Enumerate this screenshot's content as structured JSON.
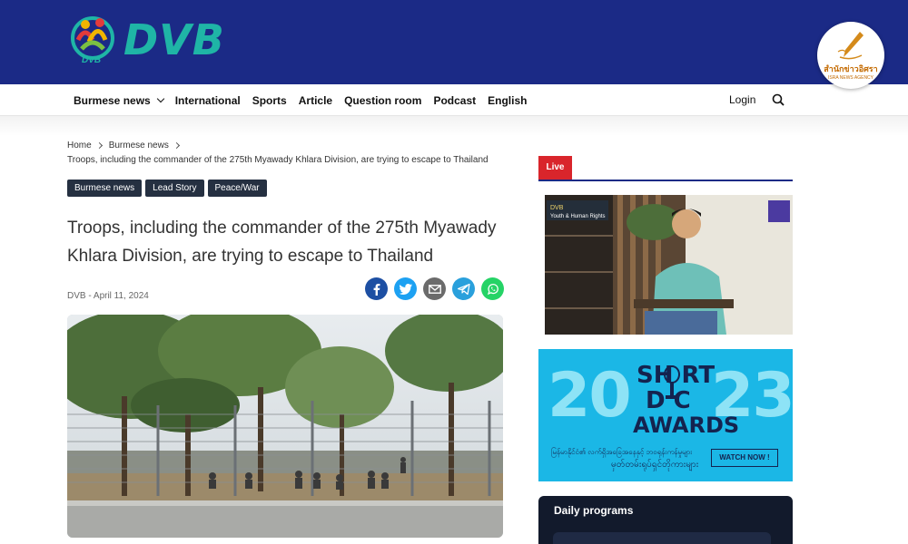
{
  "header": {
    "logo_text": "DVB",
    "logo_sub": "DVB",
    "badge": {
      "title": "สำนักข่าวอิศรา",
      "subtitle": "ISRA NEWS AGENCY"
    }
  },
  "nav": {
    "items": [
      {
        "label": "Burmese news",
        "has_dropdown": true
      },
      {
        "label": "International"
      },
      {
        "label": "Sports"
      },
      {
        "label": "Article"
      },
      {
        "label": "Question room"
      },
      {
        "label": "Podcast"
      },
      {
        "label": "English"
      }
    ],
    "login": "Login",
    "search_icon": "search-icon"
  },
  "article": {
    "breadcrumb": {
      "home": "Home",
      "section": "Burmese news",
      "current": "Troops, including the commander of the 275th Myawady Khlara Division, are trying to escape to Thailand"
    },
    "tags": [
      "Burmese news",
      "Lead Story",
      "Peace/War"
    ],
    "headline": "Troops, including the commander of the 275th Myawady Khlara Division, are trying to escape to Thailand",
    "meta": "DVB - April 11, 2024",
    "share": [
      {
        "icon": "facebook-icon",
        "color": "#1d4fa3"
      },
      {
        "icon": "twitter-icon",
        "color": "#1da1f2"
      },
      {
        "icon": "email-icon",
        "color": "#6b6b6b"
      },
      {
        "icon": "telegram-icon",
        "color": "#2aa0dc"
      },
      {
        "icon": "whatsapp-icon",
        "color": "#25d366"
      }
    ]
  },
  "sidebar": {
    "live_label": "Live",
    "video_overlay": "Youth & Human Rights",
    "awards": {
      "top": "SH  RT",
      "mid": "D  C",
      "words": "AWARDS",
      "num_left": "20",
      "num_right": "23",
      "mm_line1": "မြန်မာနိုင်ငံ၏ လက်ရှိအခြေအနေနှင့် ဘဝရုန်းကန်မှုများ",
      "mm_line2": "မှတ်တမ်းရုပ်ရှင်တိုကားများ",
      "watch": "WATCH NOW !"
    },
    "daily_title": "Daily programs"
  },
  "colors": {
    "header_bg": "#1b2a86",
    "accent_teal": "#1fb5a6",
    "live_red": "#d9252b",
    "tag_bg": "#253041",
    "awards_bg": "#1bb7e6"
  }
}
